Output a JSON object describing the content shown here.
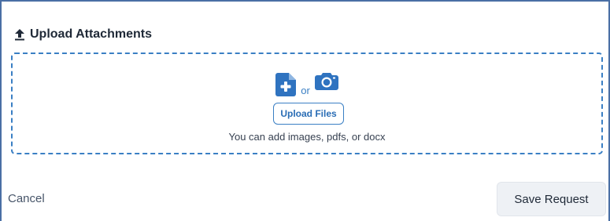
{
  "section": {
    "title": "Upload Attachments",
    "icon": "upload-arrow-icon"
  },
  "dropzone": {
    "add_file_icon": "file-plus-icon",
    "separator": "or",
    "camera_icon": "camera-icon",
    "upload_button_label": "Upload Files",
    "hint": "You can add images, pdfs, or docx"
  },
  "footer": {
    "cancel_label": "Cancel",
    "save_label": "Save Request"
  },
  "colors": {
    "accent": "#3a7fc4",
    "frame_border": "#4a6fa5",
    "save_button_bg": "#eef1f5"
  }
}
